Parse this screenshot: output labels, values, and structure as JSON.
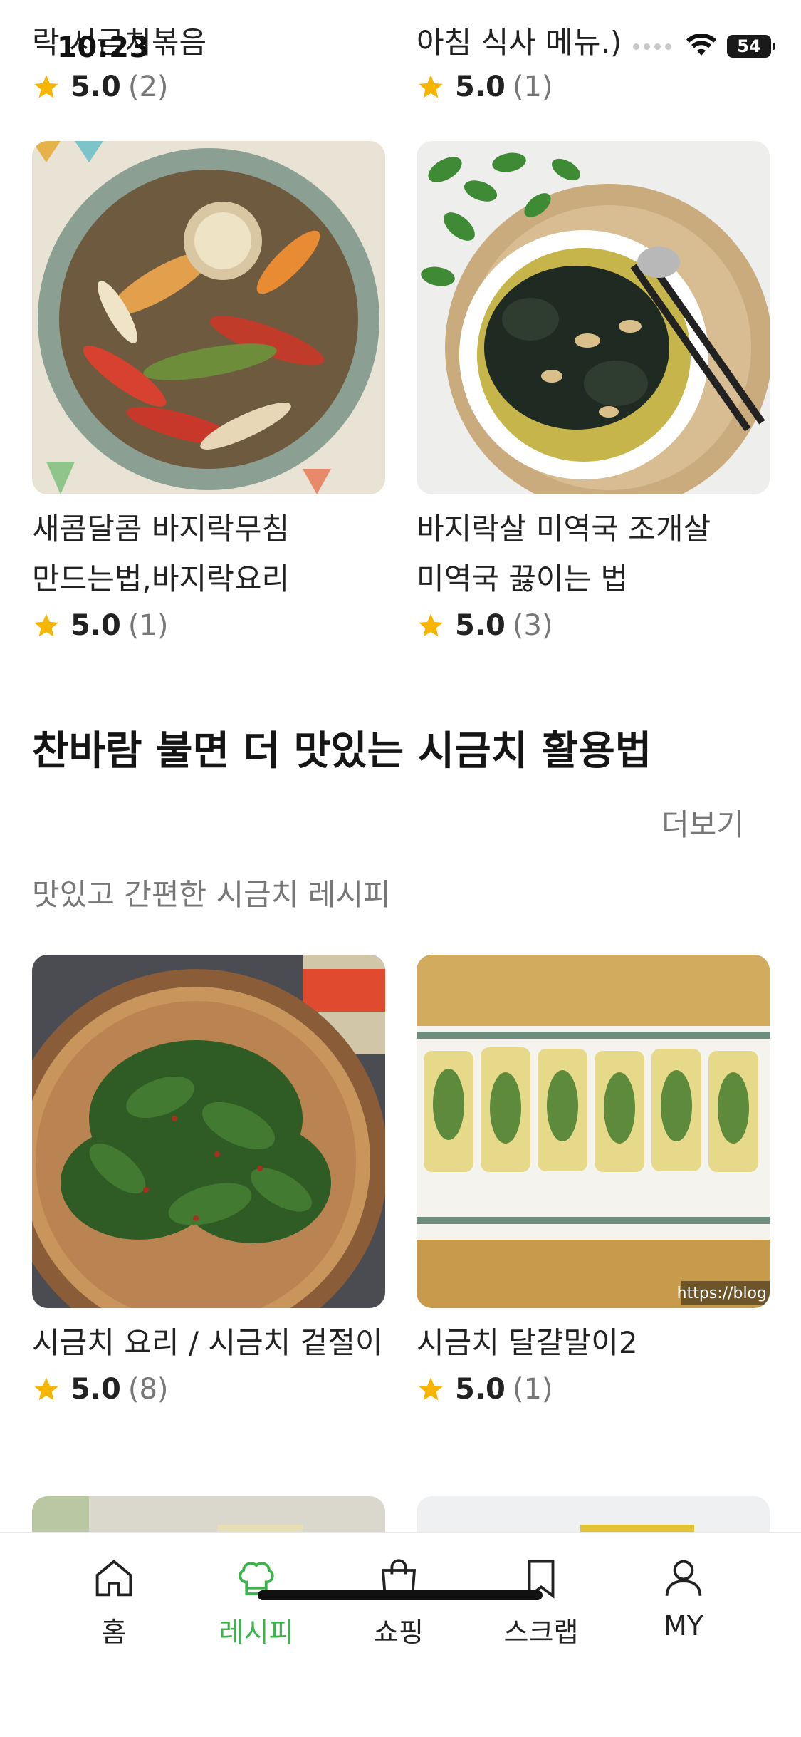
{
  "status_bar": {
    "time": "10:23",
    "battery": "54"
  },
  "top_partial": [
    {
      "title_line": "락 시금치볶음",
      "score": "5.0",
      "count": "(2)"
    },
    {
      "title_line": "아침 식사 메뉴.)",
      "score": "5.0",
      "count": "(1)"
    }
  ],
  "recipes_row1": [
    {
      "title": "새콤달콤 바지락무침 만드는법,바지락요리",
      "score": "5.0",
      "count": "(1)"
    },
    {
      "title": "바지락살 미역국 조개살 미역국 끓이는 법",
      "score": "5.0",
      "count": "(3)"
    }
  ],
  "section": {
    "title": "찬바람 불면 더 맛있는 시금치 활용법",
    "more": "더보기",
    "subtitle": "맛있고 간편한 시금치 레시피"
  },
  "recipes_row2": [
    {
      "title": "시금치 요리 / 시금치 겉절이",
      "score": "5.0",
      "count": "(8)"
    },
    {
      "title": "시금치 달걀말이2",
      "score": "5.0",
      "count": "(1)",
      "watermark": "https://blog"
    }
  ],
  "tabbar": {
    "items": [
      {
        "label": "홈",
        "icon": "home-icon"
      },
      {
        "label": "레시피",
        "icon": "chef-hat-icon",
        "active": true
      },
      {
        "label": "쇼핑",
        "icon": "shopping-bag-icon"
      },
      {
        "label": "스크랩",
        "icon": "bookmark-icon"
      },
      {
        "label": "MY",
        "icon": "person-icon"
      }
    ]
  },
  "colors": {
    "accent": "#3bb24a",
    "star": "#f7b500"
  }
}
